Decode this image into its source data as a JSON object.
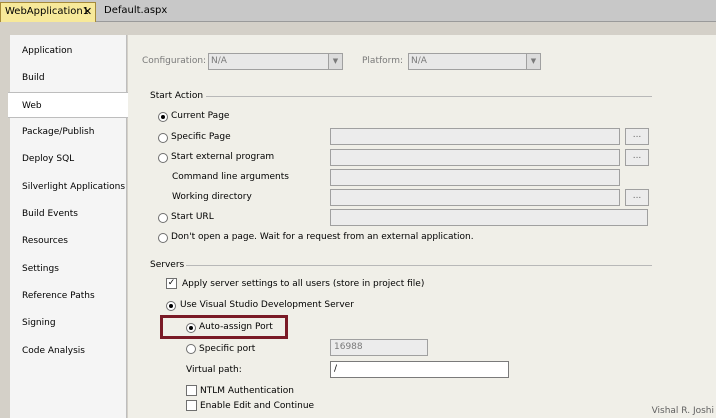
{
  "tabs": [
    {
      "label": "WebApplication1",
      "close": "✕"
    },
    {
      "label": "Default.aspx"
    }
  ],
  "sidebar": {
    "items": [
      {
        "label": "Application"
      },
      {
        "label": "Build"
      },
      {
        "label": "Web"
      },
      {
        "label": "Package/Publish"
      },
      {
        "label": "Deploy SQL"
      },
      {
        "label": "Silverlight Applications"
      },
      {
        "label": "Build Events"
      },
      {
        "label": "Resources"
      },
      {
        "label": "Settings"
      },
      {
        "label": "Reference Paths"
      },
      {
        "label": "Signing"
      },
      {
        "label": "Code Analysis"
      }
    ],
    "selected": "Web"
  },
  "config": {
    "configuration_label": "Configuration:",
    "configuration_value": "N/A",
    "platform_label": "Platform:",
    "platform_value": "N/A"
  },
  "start_action": {
    "title": "Start Action",
    "current_page": "Current Page",
    "specific_page": "Specific Page",
    "start_external": "Start external program",
    "command_args": "Command line arguments",
    "working_dir": "Working directory",
    "start_url": "Start URL",
    "dont_open": "Don't open a page.  Wait for a request from an external application.",
    "browse": "..."
  },
  "servers": {
    "title": "Servers",
    "apply_all": "Apply server settings to all users (store in project file)",
    "use_vs_dev": "Use Visual Studio Development Server",
    "auto_assign": "Auto-assign Port",
    "specific_port": "Specific port",
    "port_value": "16988",
    "virtual_path_label": "Virtual path:",
    "virtual_path_value": "/",
    "ntlm": "NTLM Authentication",
    "edit_continue": "Enable Edit and Continue"
  },
  "watermark": "Vishal R. Joshi",
  "colors": {
    "highlight": "#7a1a26",
    "active_tab": "#f7e99a"
  }
}
